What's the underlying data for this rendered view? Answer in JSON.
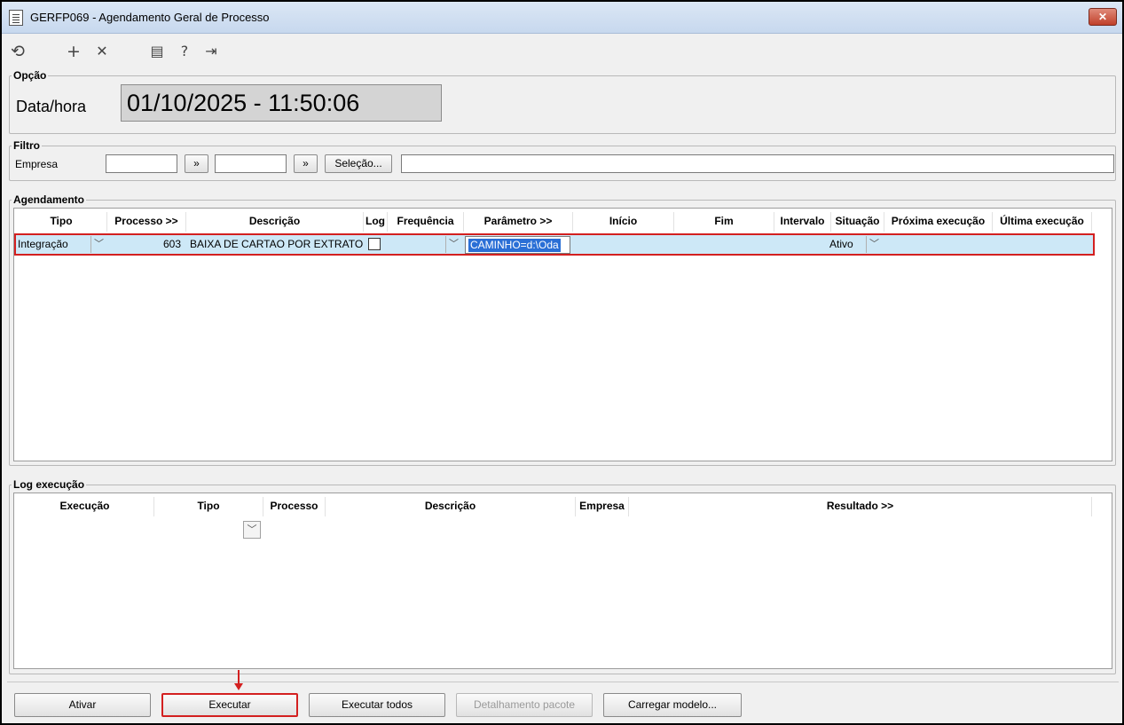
{
  "window": {
    "title": "GERFP069 - Agendamento Geral de Processo",
    "close_label": "✕"
  },
  "toolbar": {
    "icons": [
      "undo-icon",
      "add-icon",
      "delete-icon",
      "calendar-icon",
      "help-icon",
      "exit-icon"
    ]
  },
  "opcao": {
    "legend": "Opção",
    "datahora_label": "Data/hora",
    "datahora_value": "01/10/2025  -  11:50:06"
  },
  "filtro": {
    "legend": "Filtro",
    "empresa_label": "Empresa",
    "range_button_1": "»",
    "range_button_2": "»",
    "selecao_button": "Seleção..."
  },
  "agendamento": {
    "legend": "Agendamento",
    "columns": [
      "Tipo",
      "Processo >>",
      "Descrição",
      "Log",
      "Frequência",
      "Parâmetro >>",
      "Início",
      "Fim",
      "Intervalo",
      "Situação",
      "Próxima execução",
      "Última execução"
    ],
    "rows": [
      {
        "tipo": "Integração",
        "processo": "603",
        "descricao": "BAIXA DE CARTAO POR EXTRATO",
        "log_checked": false,
        "frequencia": "",
        "parametro": "CAMINHO=d:\\Oda",
        "inicio": "",
        "fim": "",
        "intervalo": "",
        "situacao": "Ativo",
        "proxima": "",
        "ultima": ""
      }
    ]
  },
  "logexec": {
    "legend": "Log execução",
    "columns": [
      "Execução",
      "Tipo",
      "Processo",
      "Descrição",
      "Empresa",
      "Resultado >>"
    ]
  },
  "buttons": {
    "ativar": "Ativar",
    "executar": "Executar",
    "executar_todos": "Executar todos",
    "detalhamento": "Detalhamento pacote",
    "carregar": "Carregar modelo..."
  },
  "colors": {
    "highlight": "#d32020",
    "selection": "#2a6fd6",
    "row_bg": "#cde8f7"
  }
}
